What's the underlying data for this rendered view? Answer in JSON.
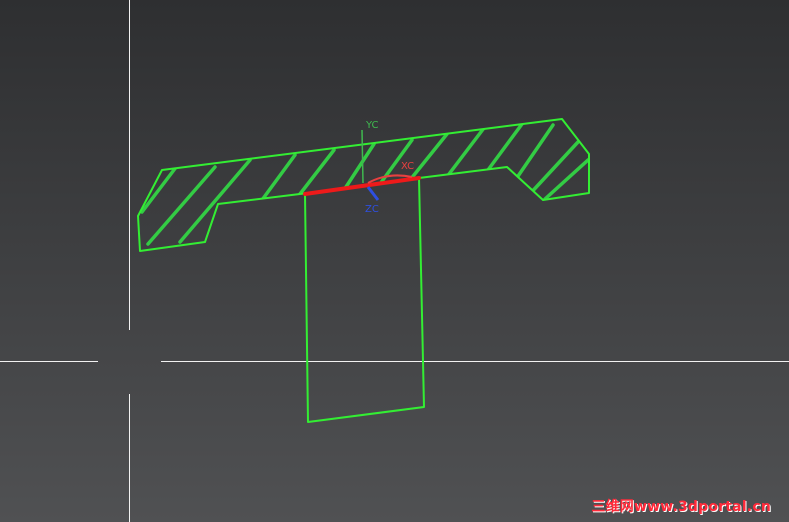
{
  "viewport": {
    "background": "#3b3c3e",
    "sketch_color": "#33ee33",
    "highlight_color": "#ee1a1a",
    "crosshair_color": "#f2f2f2"
  },
  "csys": {
    "x_label": "XC",
    "y_label": "YC",
    "z_label": "ZC",
    "x_color": "#e84040",
    "y_color": "#3fb94f",
    "z_color": "#2e4fe0"
  },
  "watermark": {
    "text": "三维网www.3dportal.cn",
    "color": "#ff2a3a"
  }
}
